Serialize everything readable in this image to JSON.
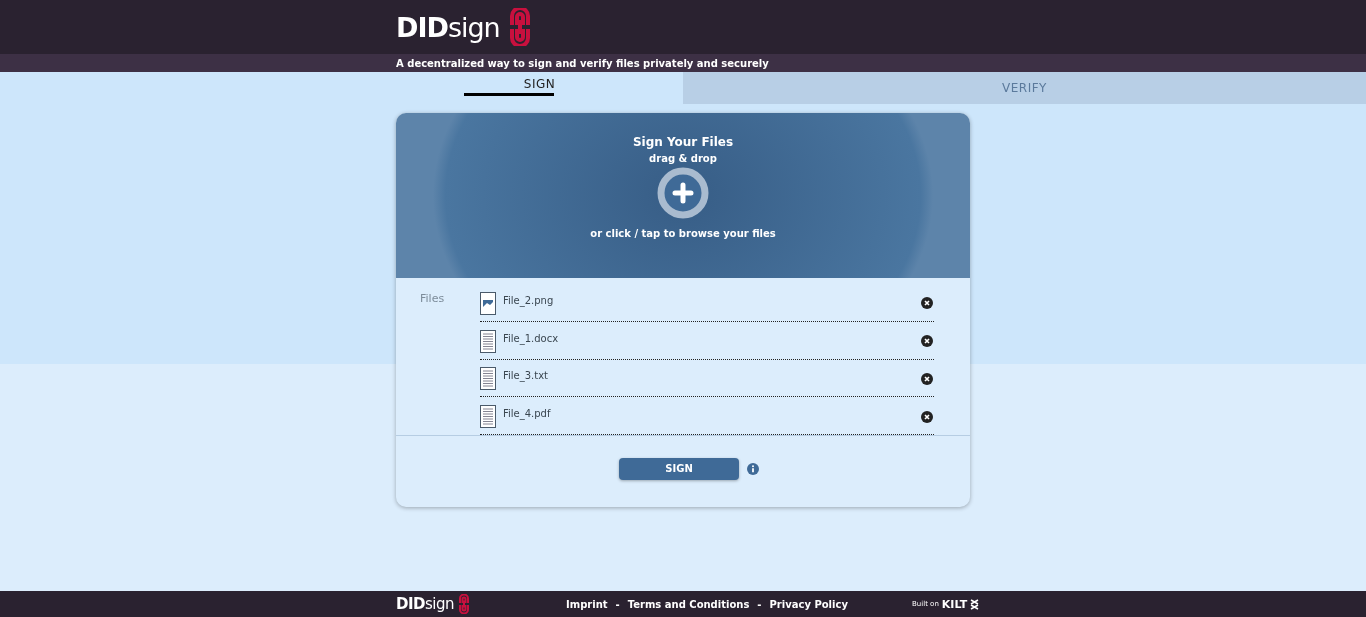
{
  "header": {
    "logo": "**DID**sign",
    "tagline": "A decentralized way to sign and verify files privately and securely"
  },
  "tabs": [
    {
      "label": "SIGN",
      "selected": true
    },
    {
      "label": "VERIFY",
      "selected": false
    }
  ],
  "dropzone": {
    "title": "Sign Your Files",
    "subtitle": "drag & drop",
    "hint": "or click / tap to browse your files"
  },
  "files": {
    "label": "Files",
    "items": [
      {
        "name": "File_2.png",
        "kind": "image"
      },
      {
        "name": "File_1.docx",
        "kind": "document"
      },
      {
        "name": "File_3.txt",
        "kind": "document"
      },
      {
        "name": "File_4.pdf",
        "kind": "document"
      }
    ]
  },
  "sign_button": "SIGN",
  "footer": {
    "logo": "**DID**sign",
    "links": [
      "Imprint",
      "Terms and Conditions",
      "Privacy Policy"
    ],
    "separators": [
      "-",
      "-"
    ],
    "built_on": "Built on",
    "kilt": "KILT"
  }
}
